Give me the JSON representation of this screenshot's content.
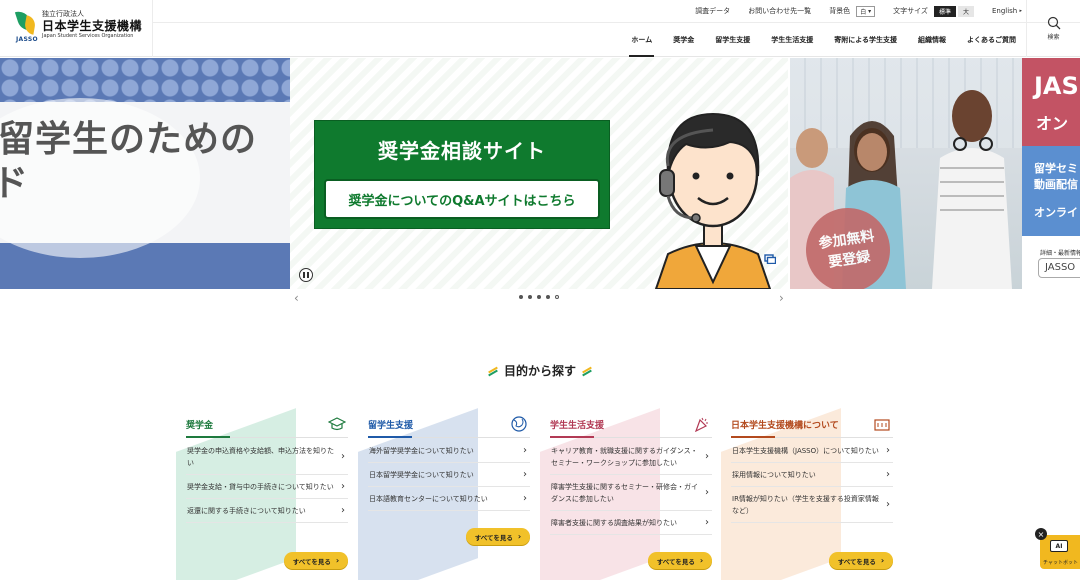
{
  "header": {
    "logo": {
      "corp_type": "独立行政法人",
      "name_ja": "日本学生支援機構",
      "name_en": "Japan Student Services Organization",
      "mark_text": "JASSO"
    },
    "utility": {
      "survey_data": "調査データ",
      "contact_list": "お問い合わせ先一覧",
      "bg_color_label": "背景色",
      "bg_color_value": "白",
      "font_size_label": "文字サイズ",
      "font_size_standard": "標準",
      "font_size_large": "大",
      "language": "English"
    },
    "nav": [
      {
        "label": "ホーム"
      },
      {
        "label": "奨学金"
      },
      {
        "label": "留学生支援"
      },
      {
        "label": "学生生活支援"
      },
      {
        "label": "寄附による学生支援"
      },
      {
        "label": "組織情報"
      },
      {
        "label": "よくあるご質問"
      }
    ],
    "search_label": "検索"
  },
  "carousel": {
    "left_slide": {
      "line1": "留学生のための",
      "line2": "ド"
    },
    "center_slide": {
      "title": "奨学金相談サイト",
      "subtitle": "奨学金についてのQ&Aサイトはこちら"
    },
    "right_slide": {
      "badge_line1": "参加無料",
      "badge_line2": "要登録"
    },
    "edge_slide": {
      "title_line1": "JAS",
      "title_line2": "オン",
      "blue_line1": "留学セミ",
      "blue_line2": "動画配信",
      "blue_line3": "オンライ",
      "info": "詳細・最新情報",
      "button": "JASSO"
    },
    "prev_arrow": "‹",
    "next_arrow": "›",
    "slide_count": 5,
    "current_slide": 5
  },
  "purpose": {
    "title": "目的から探す",
    "cards": [
      {
        "heading": "奨学金",
        "color": "#1e7a3e",
        "items": [
          "奨学金の申込資格や支給額、申込方法を知りたい",
          "奨学金支給・貸与中の手続きについて知りたい",
          "返還に関する手続きについて知りたい"
        ],
        "see_all": "すべてを見る"
      },
      {
        "heading": "留学生支援",
        "color": "#1f5aa8",
        "items": [
          "海外留学奨学金について知りたい",
          "日本留学奨学金について知りたい",
          "日本語教育センターについて知りたい"
        ],
        "see_all": "すべてを見る"
      },
      {
        "heading": "学生生活支援",
        "color": "#b23a55",
        "items": [
          "キャリア教育・就職支援に関するガイダンス・セミナー・ワークショップに参加したい",
          "障害学生支援に関するセミナー・研修会・ガイダンスに参加したい",
          "障害者支援に関する調査結果が知りたい"
        ],
        "see_all": "すべてを見る"
      },
      {
        "heading": "日本学生支援機構について",
        "color": "#b34a1e",
        "items": [
          "日本学生支援機構（JASSO）について知りたい",
          "採用情報について知りたい",
          "IR情報が知りたい（学生を支援する投資家情報など）"
        ],
        "see_all": "すべてを見る"
      }
    ]
  },
  "chatbot": {
    "label": "チャットボット",
    "badge": "AI",
    "close": "×"
  }
}
